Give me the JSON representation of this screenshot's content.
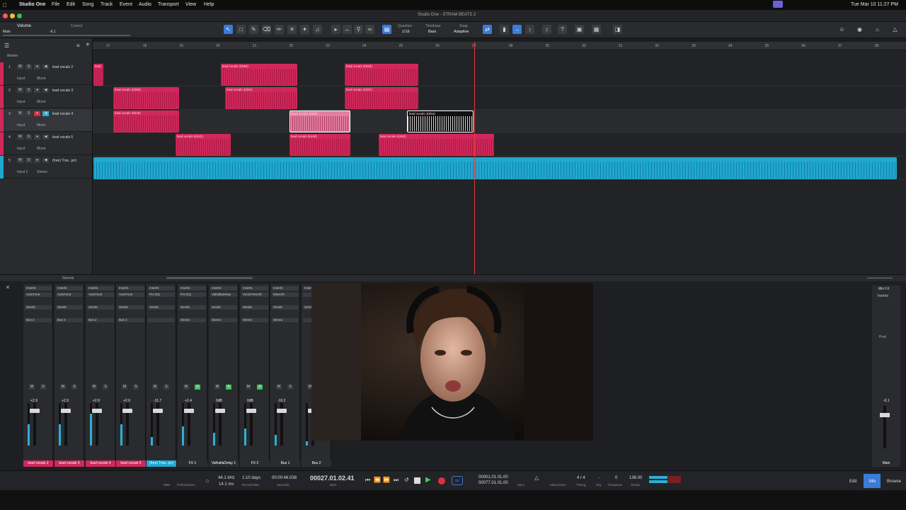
{
  "menubar": {
    "app": "Studio One",
    "items": [
      "File",
      "Edit",
      "Song",
      "Track",
      "Event",
      "Audio",
      "Transport",
      "View",
      "Help"
    ],
    "clock": "Tue Mar 10  11:27 PM"
  },
  "window": {
    "title": "Studio One - STRAM BEATS 2"
  },
  "toolbar": {
    "volume_label": "Volume",
    "main_label": "Main",
    "main_value": "-6.1",
    "control_label": "Control",
    "quantize_label": "Quantize",
    "quantize_value": "1/16",
    "timebase_label": "Timebase",
    "timebase_value": "Bars",
    "snap_label": "Snap",
    "snap_value": "Adaptive"
  },
  "track_panel": {
    "marker_label": "Marker"
  },
  "ruler": {
    "bars": [
      "17",
      "18",
      "19",
      "20",
      "21",
      "22",
      "23",
      "24",
      "25",
      "26",
      "27",
      "28",
      "29",
      "30",
      "31",
      "32",
      "33",
      "34",
      "35",
      "36",
      "37",
      "38"
    ]
  },
  "tracks": [
    {
      "num": "1",
      "name": "lead vocals 2",
      "input": "Input",
      "mode": "Mono",
      "color": "#d0285a"
    },
    {
      "num": "2",
      "name": "lead vocals 3",
      "input": "Input",
      "mode": "Mono",
      "color": "#d0285a"
    },
    {
      "num": "3",
      "name": "lead vocals 4",
      "input": "Input",
      "mode": "Mono",
      "color": "#d0285a"
    },
    {
      "num": "4",
      "name": "lead vocals 5",
      "input": "Input",
      "mode": "Mono",
      "color": "#d0285a"
    },
    {
      "num": "5",
      "name": "(free) Trav...jer)",
      "input": "Input 1",
      "mode": "Stereo",
      "color": "#1fa8d0"
    }
  ],
  "clips": [
    {
      "lane": 0,
      "name": "lead",
      "sel": false
    },
    {
      "lane": 0,
      "name": "lead vocals 2(586)",
      "sel": false
    },
    {
      "lane": 0,
      "name": "lead vocals 2(590)",
      "sel": false
    },
    {
      "lane": 1,
      "name": "lead vocals 3(390)",
      "sel": false
    },
    {
      "lane": 1,
      "name": "lead vocals 3(391)",
      "sel": false
    },
    {
      "lane": 1,
      "name": "lead vocals 3(397)",
      "sel": false
    },
    {
      "lane": 2,
      "name": "lead vocals 4(546)",
      "sel": false
    },
    {
      "lane": 2,
      "name": "lead vocals 4(550)",
      "sel": "pink"
    },
    {
      "lane": 2,
      "name": "lead vocals 4(554)",
      "sel": "white"
    },
    {
      "lane": 3,
      "name": "lead vocals 5(442)",
      "sel": false
    },
    {
      "lane": 3,
      "name": "lead vocals 5(448)",
      "sel": false
    },
    {
      "lane": 3,
      "name": "lead vocals 5(452)",
      "sel": false
    }
  ],
  "arrange_footer": {
    "mode": "Normal"
  },
  "mixer": {
    "strips": [
      {
        "name": "lead vocals 2",
        "db": "+2.9",
        "insert": "AutoTune",
        "bus": "Bus 2",
        "color": "#d0285a"
      },
      {
        "name": "lead vocals 3",
        "db": "+2.9",
        "insert": "AutoTune",
        "bus": "Bus 2",
        "color": "#d0285a"
      },
      {
        "name": "lead vocals 4",
        "db": "+2.9",
        "insert": "AutoTune",
        "bus": "Bus 2",
        "color": "#d0285a"
      },
      {
        "name": "lead vocals 5",
        "db": "+2.9",
        "insert": "AutoTune",
        "bus": "Bus 2",
        "color": "#d0285a"
      },
      {
        "name": "(free) Trav...jer)",
        "db": "-11.7",
        "insert": "Pro EQ",
        "bus": "",
        "color": "#1fa8d0"
      },
      {
        "name": "FX 1",
        "db": "+2.4",
        "insert": "Pro EQ",
        "bus": "Stereo",
        "color": "#2b2c30"
      },
      {
        "name": "ValhallaDelay 1",
        "db": "0dB",
        "insert": "ValhallaDelay",
        "bus": "Stereo",
        "color": "#2b2c30"
      },
      {
        "name": "FX 2",
        "db": "0dB",
        "insert": "Vocal Reverb",
        "bus": "Stereo",
        "color": "#2b2c30"
      },
      {
        "name": "Bus 1",
        "db": "-10.2",
        "insert": "Mixverb",
        "bus": "Stereo",
        "color": "#2b2c30"
      },
      {
        "name": "Bus 2",
        "db": "",
        "insert": "",
        "bus": "",
        "color": "#2b2c30"
      }
    ],
    "labels": {
      "inserts": "Inserts",
      "sends": "Sends",
      "mixfx": "Mix FX",
      "post": "Post",
      "main": "Main",
      "main_db": "-0.1"
    }
  },
  "transport": {
    "midi": "MIDI",
    "performance": "Performance",
    "sample_rate": "44.1 kHz",
    "latency": "14.1 ms",
    "record_max": "1:10 days",
    "record_max_label": "Record Max",
    "seconds": "00:00:46.038",
    "seconds_label": "Seconds",
    "position": "00027.01.02.41",
    "position_label": "Bars",
    "loop_start": "00001.01.01.00",
    "loop_end": "00077.01.01.00",
    "sync_label": "Sync",
    "metronome_label": "Metronome",
    "timing_value": "4 / 4",
    "timing_label": "Timing",
    "key_value": "-",
    "key_label": "Key",
    "transpose_value": "0",
    "transpose_label": "Transpose",
    "tempo_value": "136.00",
    "tempo_label": "Tempo",
    "edit": "Edit",
    "mix": "Mix",
    "browse": "Browse"
  }
}
